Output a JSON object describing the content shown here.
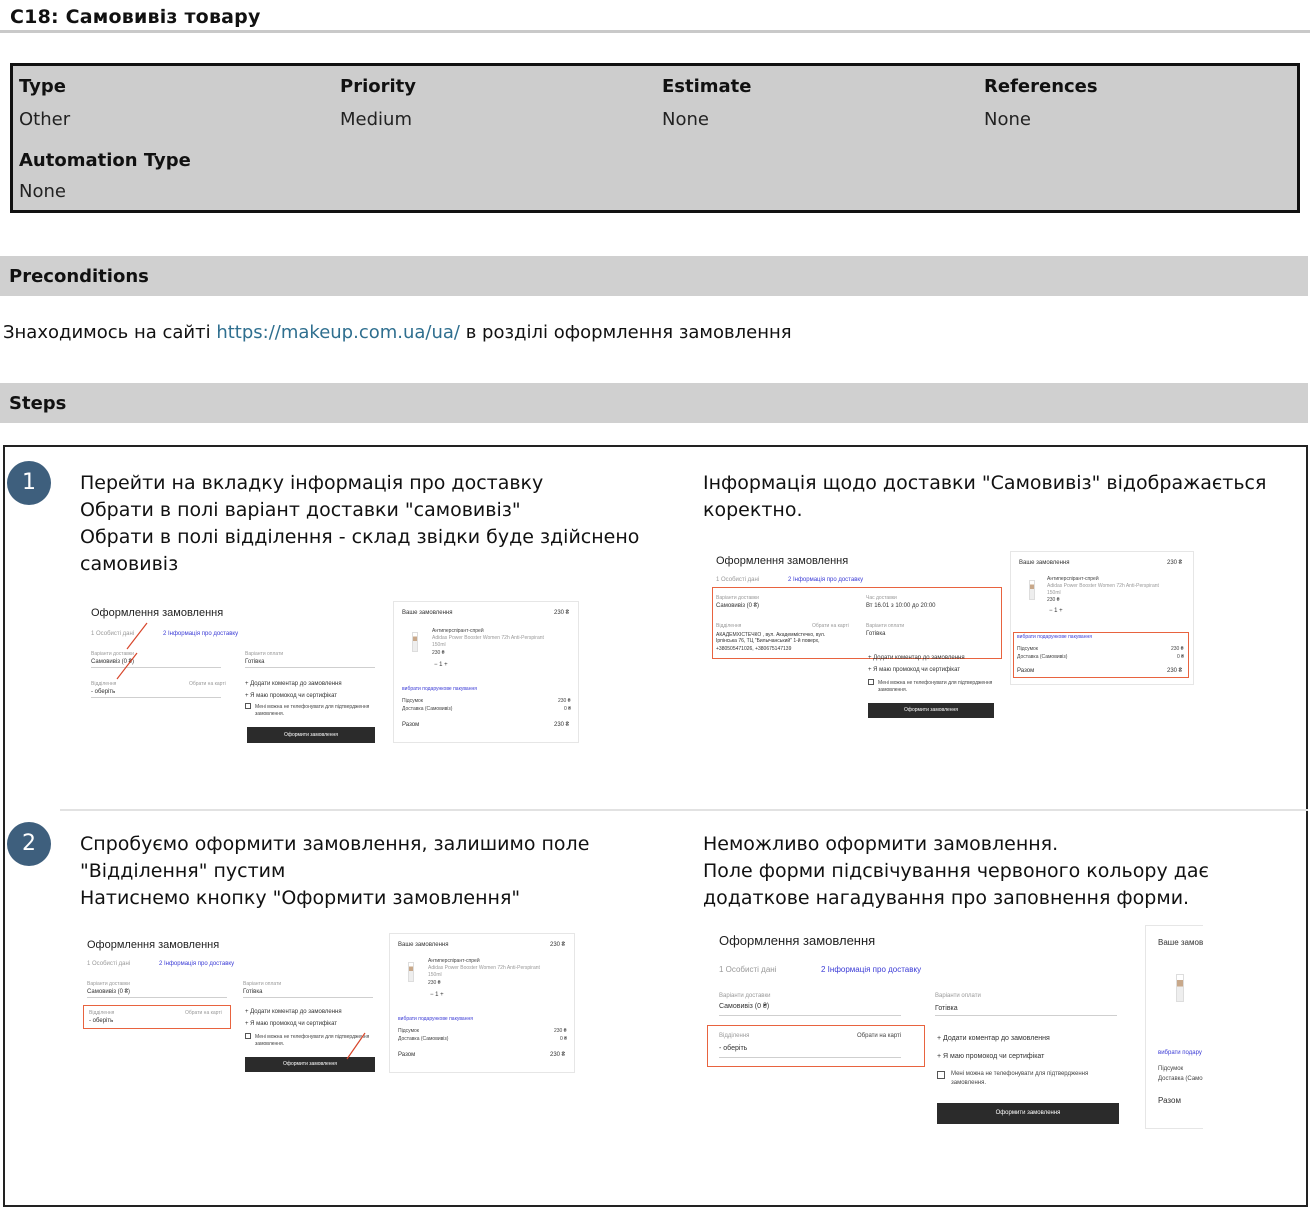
{
  "page": {
    "title": "C18: Самовивіз товару"
  },
  "meta": {
    "type_label": "Type",
    "type_value": "Other",
    "priority_label": "Priority",
    "priority_value": "Medium",
    "estimate_label": "Estimate",
    "estimate_value": "None",
    "references_label": "References",
    "references_value": "None",
    "automation_label": "Automation Type",
    "automation_value": "None"
  },
  "preconditions": {
    "header": "Preconditions",
    "text_before": "Знаходимось на сайті ",
    "link": "https://makeup.com.ua/ua/",
    "text_after": " в розділі оформлення замовлення"
  },
  "steps": {
    "header": "Steps",
    "items": [
      {
        "number": "1",
        "action_lines": [
          "Перейти на вкладку інформація про доставку",
          "Обрати в полі варіант доставки \"самовивіз\"",
          "Обрати в полі відділення - склад звідки буде здійснено",
          "самовивіз"
        ],
        "expected_lines": [
          "Інформація щодо доставки \"Самовивіз\" відображається",
          "коректно."
        ]
      },
      {
        "number": "2",
        "action_lines": [
          "Спробуємо оформити замовлення, залишимо поле",
          "\"Відділення\" пустим",
          "Натиснемо кнопку \"Оформити замовлення\""
        ],
        "expected_lines": [
          "Неможливо оформити замовлення.",
          "Поле форми підсвічування червоного кольору дає",
          "додаткове нагадування про заповнення форми."
        ]
      }
    ]
  },
  "shot": {
    "heading": "Оформлення замовлення",
    "tab1": "1  Особисті дані",
    "tab2": "2  Інформація про доставку",
    "delivery_label": "Варіанти доставки",
    "delivery_value": "Самовивіз (0 ₴)",
    "payment_label": "Варіанти оплати",
    "payment_value": "Готівка",
    "branch_label": "Відділення",
    "branch_map": "Обрати на карті",
    "branch_placeholder": "- оберіть",
    "branch_value": "АКАДЕМХІСТЕЧКО , вул. Академмістечко, вул. Ірпінська 76, ТЦ \"Билычанський\" 1-й поверх,",
    "branch_phone": "+380505471026, +380675147139",
    "time_label": "Час доставки",
    "time_value": "Вт 16.01 з 10:00 до 20:00",
    "payment_label2": "Варіанти оплати",
    "add_comment": "+ Додати коментар до замовлення",
    "promo": "+ Я маю промокод чи сертифікат",
    "no_call": "Мені можна не телефонувати для підтвердження",
    "no_call2": "замовлення.",
    "submit": "Оформити замовлення",
    "order_title": "Ваше замовлення",
    "order_title_cut": "Ваше замов",
    "order_sum": "230 ₴",
    "product_title": "Антиперспірант-спрей",
    "product_desc": "Adidas Power Booster Women 72h Anti-Perspirant",
    "product_desc2": "150ml",
    "qty": "−  1  +",
    "gift": "вибрати подарункове пакування",
    "gift_cut": "вибрати подару",
    "subtotal_label": "Підсумок",
    "subtotal_value": "230 ₴",
    "delivery_row": "Доставка (Самовивіз)",
    "delivery_row_cut": "Доставка (Само",
    "delivery_row_value": "0 ₴",
    "total_label": "Разом",
    "total_value": "230 ₴"
  }
}
